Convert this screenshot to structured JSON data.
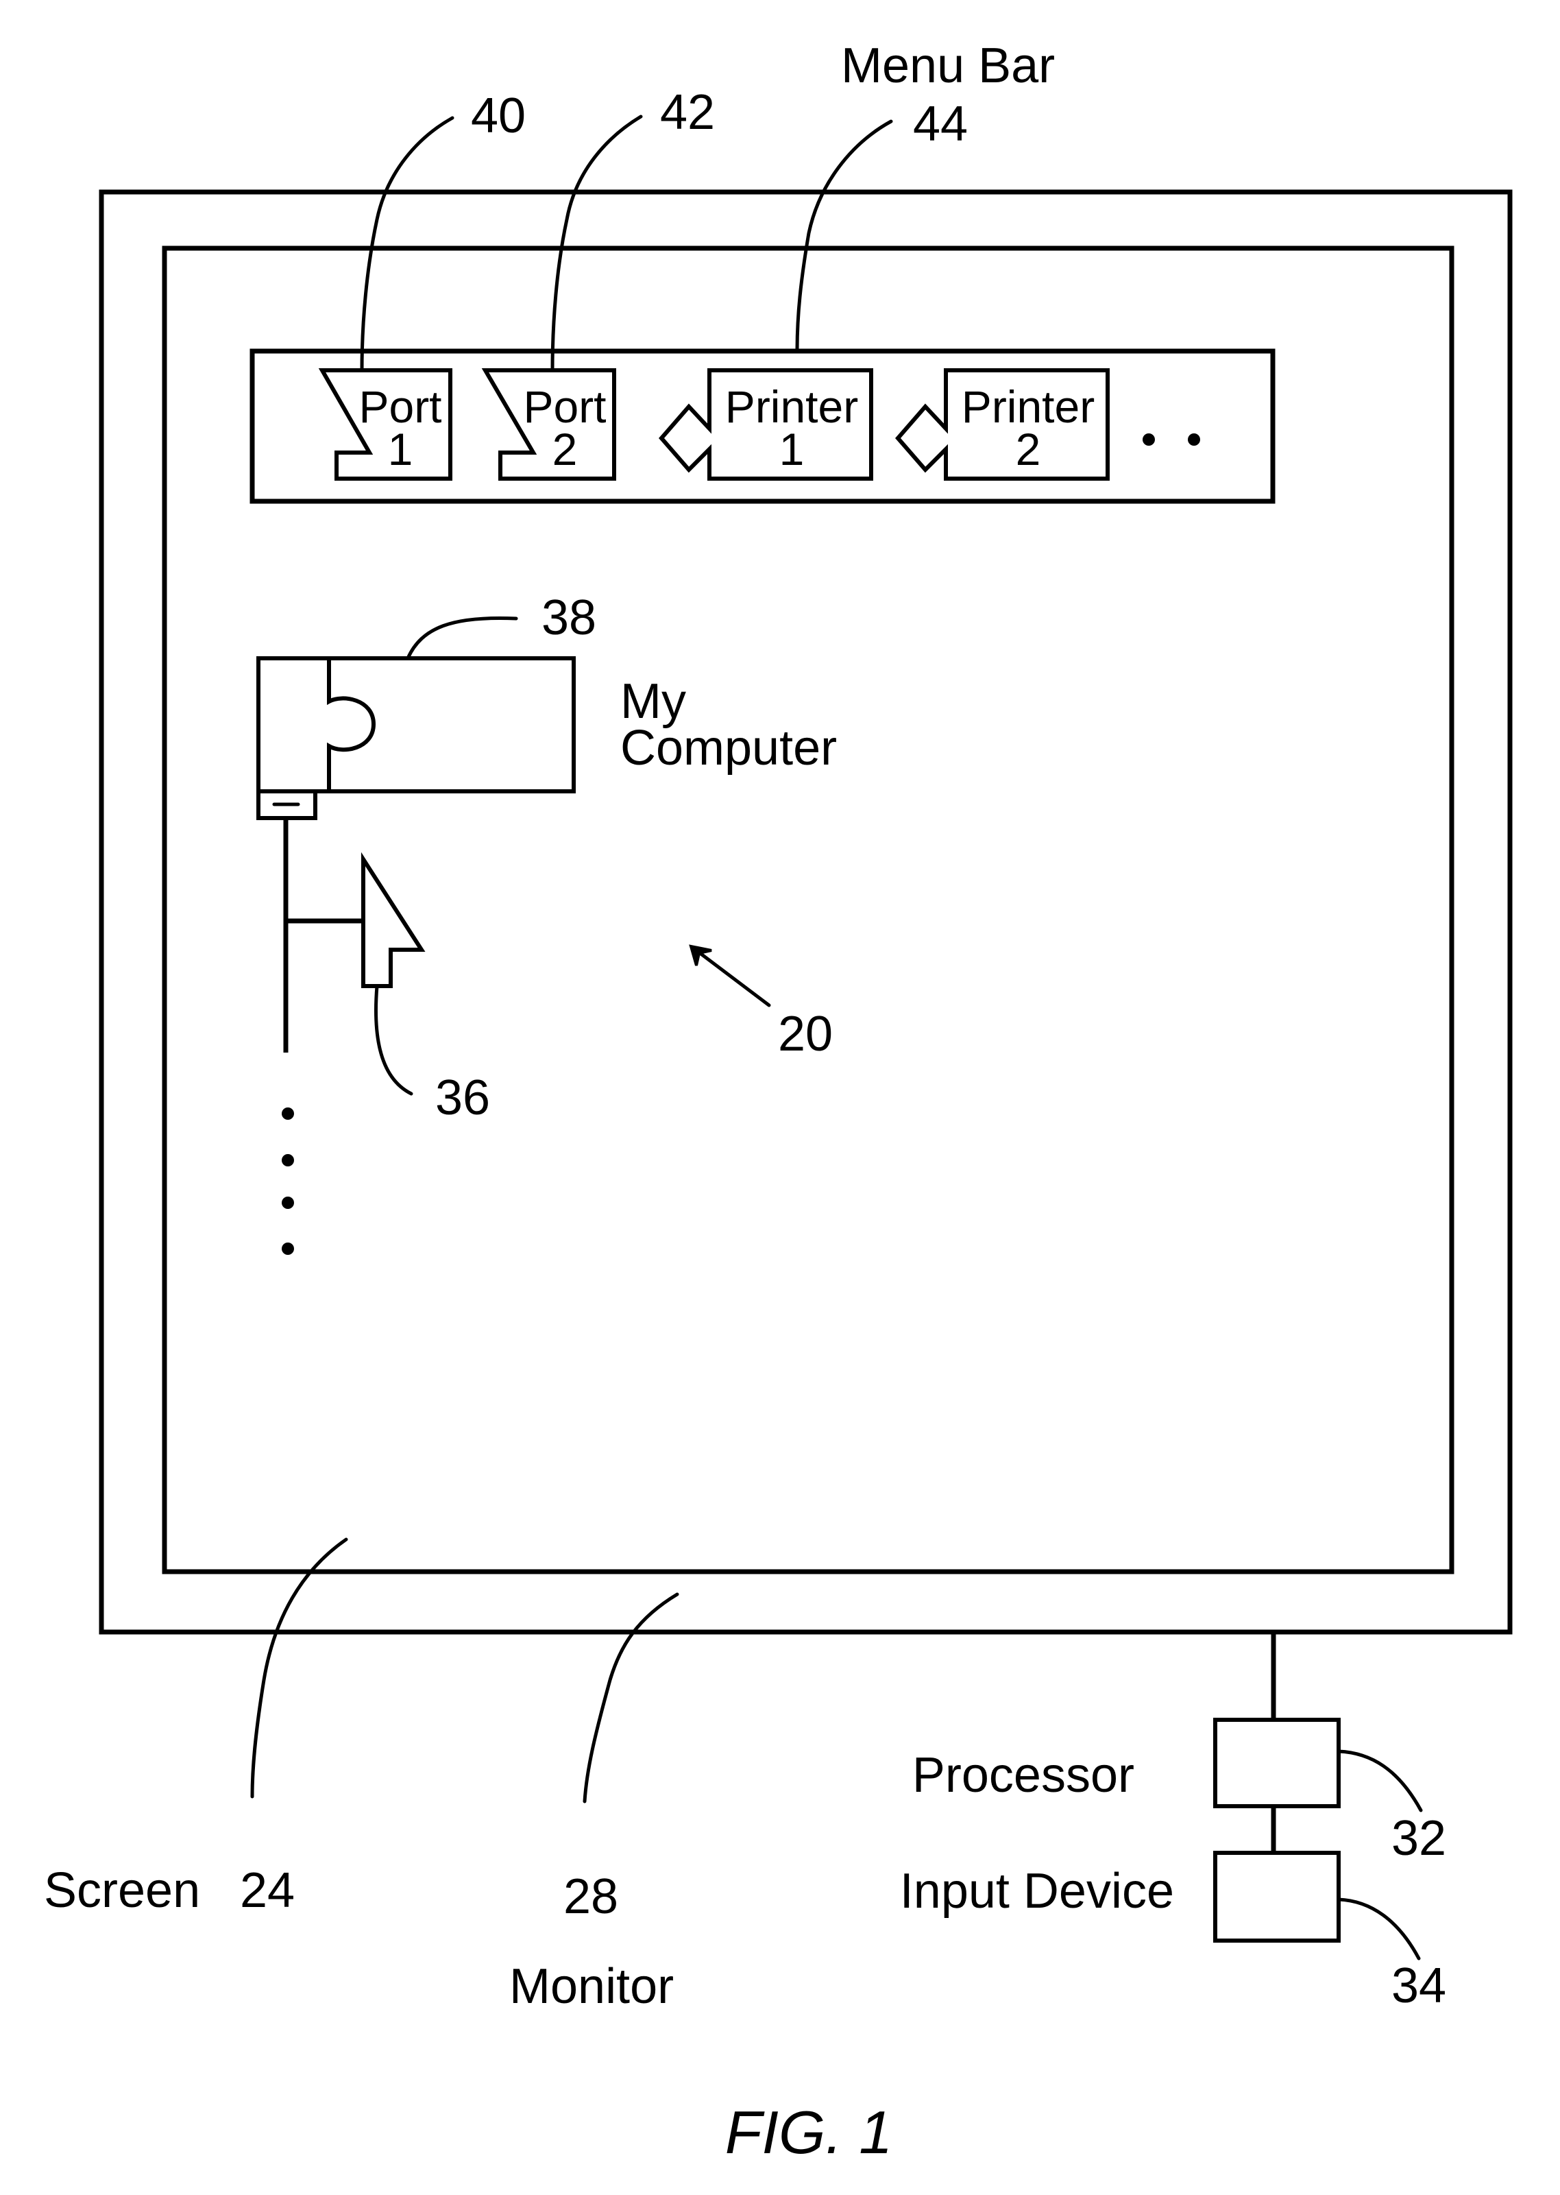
{
  "figure": {
    "caption": "FIG. 1",
    "reference_numeral": "20"
  },
  "monitor": {
    "label": "Monitor",
    "numeral": "28"
  },
  "screen": {
    "label": "Screen",
    "numeral": "24"
  },
  "menu_bar": {
    "label": "Menu Bar",
    "numeral": "44",
    "items": [
      {
        "kind": "port",
        "line1": "Port",
        "line2": "1",
        "numeral": "40",
        "icon": "port-connector-icon"
      },
      {
        "kind": "port",
        "line1": "Port",
        "line2": "2",
        "numeral": "42",
        "icon": "port-connector-icon"
      },
      {
        "kind": "printer",
        "line1": "Printer",
        "line2": "1",
        "icon": "printer-connector-icon"
      },
      {
        "kind": "printer",
        "line1": "Printer",
        "line2": "2",
        "icon": "printer-connector-icon"
      }
    ],
    "overflow": "more-items-ellipsis"
  },
  "desktop_icon": {
    "label_line1": "My",
    "label_line2": "Computer",
    "numeral": "38",
    "icon": "puzzle-piece-icon"
  },
  "cursor": {
    "numeral": "36",
    "icon": "arrow-cursor-icon"
  },
  "hardware": {
    "processor": {
      "label": "Processor",
      "numeral": "32"
    },
    "input_device": {
      "label": "Input Device",
      "numeral": "34"
    }
  }
}
